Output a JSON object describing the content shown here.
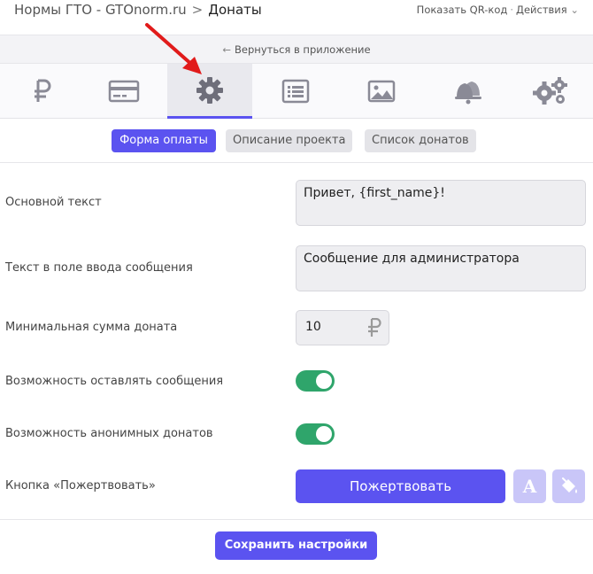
{
  "header": {
    "app_name": "Нормы ГТО - GTOnorm.ru",
    "separator": ">",
    "page": "Донаты",
    "show_qr": "Показать QR-код",
    "dot": "·",
    "actions": "Действия",
    "actions_chevron": "⌄"
  },
  "backbar": {
    "arrow": "←",
    "label": "Вернуться в приложение"
  },
  "tabs": [
    {
      "icon": "ruble-icon"
    },
    {
      "icon": "credit-card-icon"
    },
    {
      "icon": "gear-icon",
      "active": true
    },
    {
      "icon": "list-icon"
    },
    {
      "icon": "image-icon"
    },
    {
      "icon": "bell-icon"
    },
    {
      "icon": "gears-icon"
    }
  ],
  "subtabs": {
    "payment_form": "Форма оплаты",
    "project_description": "Описание проекта",
    "donation_list": "Список донатов"
  },
  "form": {
    "main_text_label": "Основной текст",
    "main_text_value": "Привет, {first_name}!",
    "message_field_label": "Текст в поле ввода сообщения",
    "message_field_value": "Сообщение для администратора",
    "min_amount_label": "Минимальная сумма доната",
    "min_amount_value": "10",
    "currency_symbol": "₽",
    "allow_messages_label": "Возможность оставлять сообщения",
    "allow_messages_on": true,
    "anonymous_label": "Возможность анонимных донатов",
    "anonymous_on": true,
    "donate_button_label": "Кнопка «Пожертвовать»",
    "donate_button_text": "Пожертвовать",
    "text_color_glyph": "A"
  },
  "save_label": "Сохранить настройки",
  "colors": {
    "accent": "#5b53f0",
    "toggle_on": "#2fa56b",
    "annotation_arrow": "#e11b1b"
  }
}
